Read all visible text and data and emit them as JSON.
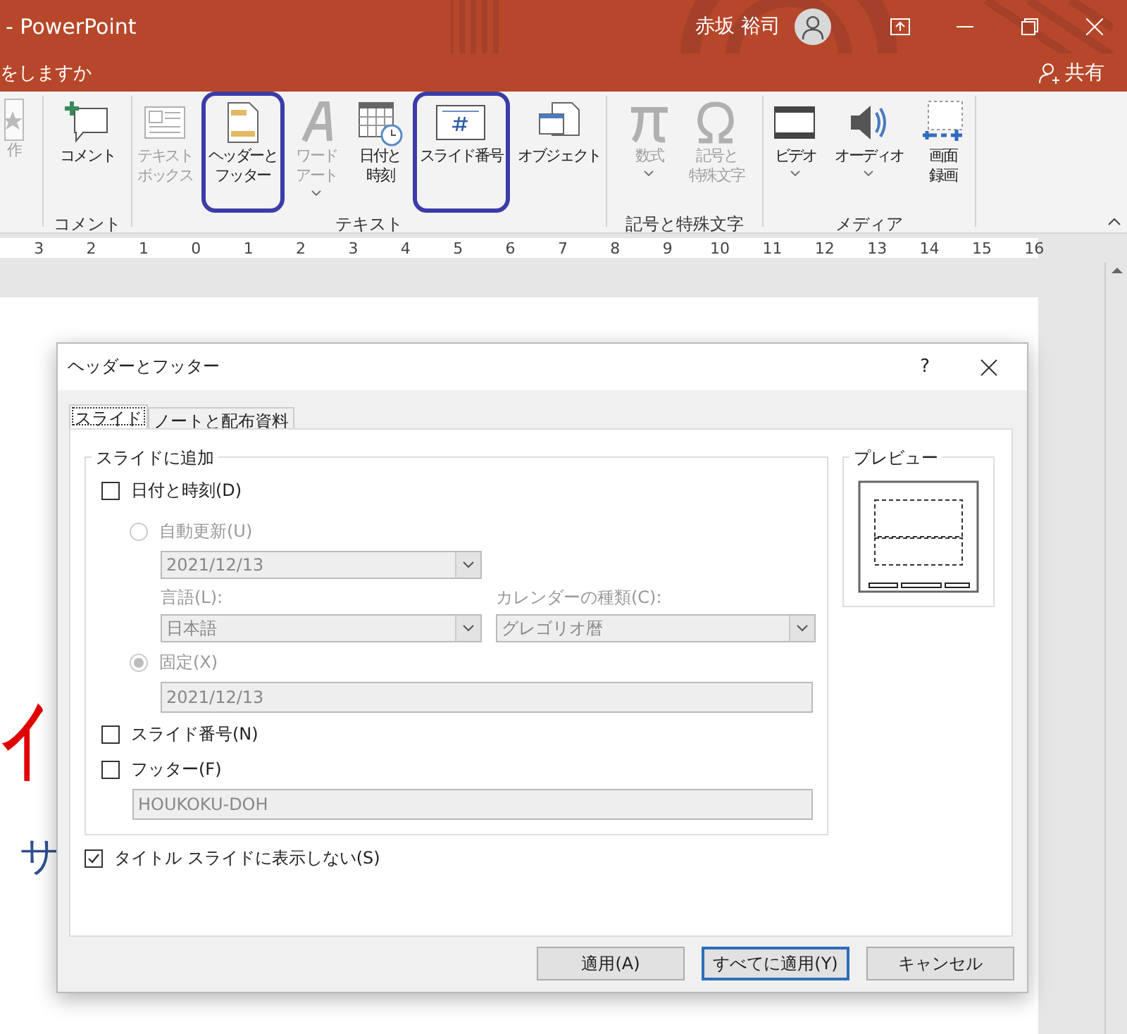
{
  "window": {
    "title": "- PowerPoint",
    "user": "赤坂 裕司"
  },
  "tell_me": {
    "text": "をしますか"
  },
  "share": {
    "label": "共有"
  },
  "ribbon": {
    "groups": [
      {
        "buttons": [
          {
            "kind": "star",
            "lines": [
              "作"
            ],
            "disabled": true,
            "dropdown": false,
            "highlighted": false
          }
        ]
      },
      {
        "label": "コメント",
        "buttons": [
          {
            "kind": "comment",
            "lines": [
              "コメント"
            ],
            "disabled": false,
            "dropdown": false,
            "highlighted": false
          }
        ]
      },
      {
        "label": "テキスト",
        "buttons": [
          {
            "kind": "textbox",
            "lines": [
              "テキスト",
              "ボックス"
            ],
            "disabled": true,
            "dropdown": false,
            "highlighted": false
          },
          {
            "kind": "header_footer",
            "lines": [
              "ヘッダーと",
              "フッター"
            ],
            "disabled": false,
            "dropdown": false,
            "highlighted": true
          },
          {
            "kind": "wordart",
            "lines": [
              "ワード",
              "アート"
            ],
            "disabled": true,
            "dropdown": true,
            "highlighted": false
          },
          {
            "kind": "calendar",
            "lines": [
              "日付と",
              "時刻"
            ],
            "disabled": false,
            "dropdown": false,
            "highlighted": false
          },
          {
            "kind": "slide_number",
            "lines": [
              "スライド番号"
            ],
            "disabled": false,
            "dropdown": false,
            "highlighted": true
          },
          {
            "kind": "object",
            "lines": [
              "オブジェクト"
            ],
            "disabled": false,
            "dropdown": false,
            "highlighted": false
          }
        ]
      },
      {
        "label": "記号と特殊文字",
        "buttons": [
          {
            "kind": "pi",
            "lines": [
              "数式"
            ],
            "disabled": true,
            "dropdown": true,
            "highlighted": false
          },
          {
            "kind": "omega",
            "lines": [
              "記号と",
              "特殊文字"
            ],
            "disabled": true,
            "dropdown": false,
            "highlighted": false
          }
        ]
      },
      {
        "label": "メディア",
        "buttons": [
          {
            "kind": "video",
            "lines": [
              "ビデオ"
            ],
            "disabled": false,
            "dropdown": true,
            "highlighted": false
          },
          {
            "kind": "audio",
            "lines": [
              "オーディオ"
            ],
            "disabled": false,
            "dropdown": true,
            "highlighted": false
          },
          {
            "kind": "record",
            "lines": [
              "画面",
              "録画"
            ],
            "disabled": false,
            "dropdown": false,
            "highlighted": false
          }
        ]
      }
    ]
  },
  "ruler": {
    "ticks": [
      "3",
      "2",
      "1",
      "0",
      "1",
      "2",
      "3",
      "4",
      "5",
      "6",
      "7",
      "8",
      "9",
      "10",
      "11",
      "12",
      "13",
      "14",
      "15",
      "16"
    ]
  },
  "slide": {
    "title_fragment": "イ",
    "subtitle_fragment": "サ"
  },
  "dialog": {
    "title": "ヘッダーとフッター",
    "help": "?",
    "tabs": [
      {
        "label": "スライド",
        "selected": true
      },
      {
        "label": "ノートと配布資料",
        "selected": false
      }
    ],
    "group_legend": "スライドに追加",
    "date_time": {
      "label": "日付と時刻(D)",
      "checked": false
    },
    "auto_update": {
      "label": "自動更新(U)",
      "selected": false,
      "disabled": true,
      "value": "2021/12/13"
    },
    "language": {
      "label": "言語(L):",
      "value": "日本語",
      "disabled": true
    },
    "calendar": {
      "label": "カレンダーの種類(C):",
      "value": "グレゴリオ暦",
      "disabled": true
    },
    "fixed": {
      "label": "固定(X)",
      "selected": true,
      "disabled": true,
      "value": "2021/12/13"
    },
    "slide_number": {
      "label": "スライド番号(N)",
      "checked": false
    },
    "footer": {
      "label": "フッター(F)",
      "checked": false,
      "value": "HOUKOKU-DOH",
      "disabled": true
    },
    "hide_on_title": {
      "label": "タイトル スライドに表示しない(S)",
      "checked": true
    },
    "preview": {
      "legend": "プレビュー"
    },
    "buttons": [
      {
        "label": "適用(A)",
        "default": false
      },
      {
        "label": "すべてに適用(Y)",
        "default": true
      },
      {
        "label": "キャンセル",
        "default": false
      }
    ]
  }
}
